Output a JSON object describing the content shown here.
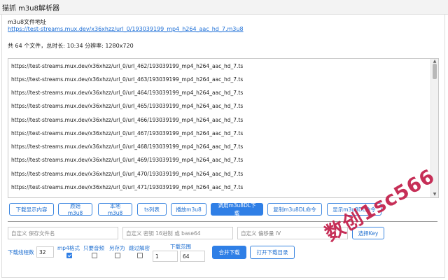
{
  "window": {
    "title": "猫抓 m3u8解析器"
  },
  "source": {
    "label": "m3u8文件地址",
    "url": "https://test-streams.mux.dev/x36xhzz/url_0/193039199_mp4_h264_aac_hd_7.m3u8"
  },
  "summary": "共 64 个文件，总时长: 10:34 分辨率: 1280x720",
  "files": [
    "https://test-streams.mux.dev/x36xhzz/url_0/url_462/193039199_mp4_h264_aac_hd_7.ts",
    "https://test-streams.mux.dev/x36xhzz/url_0/url_463/193039199_mp4_h264_aac_hd_7.ts",
    "https://test-streams.mux.dev/x36xhzz/url_0/url_464/193039199_mp4_h264_aac_hd_7.ts",
    "https://test-streams.mux.dev/x36xhzz/url_0/url_465/193039199_mp4_h264_aac_hd_7.ts",
    "https://test-streams.mux.dev/x36xhzz/url_0/url_466/193039199_mp4_h264_aac_hd_7.ts",
    "https://test-streams.mux.dev/x36xhzz/url_0/url_467/193039199_mp4_h264_aac_hd_7.ts",
    "https://test-streams.mux.dev/x36xhzz/url_0/url_468/193039199_mp4_h264_aac_hd_7.ts",
    "https://test-streams.mux.dev/x36xhzz/url_0/url_469/193039199_mp4_h264_aac_hd_7.ts",
    "https://test-streams.mux.dev/x36xhzz/url_0/url_470/193039199_mp4_h264_aac_hd_7.ts",
    "https://test-streams.mux.dev/x36xhzz/url_0/url_471/193039199_mp4_h264_aac_hd_7.ts"
  ],
  "buttons": {
    "show_download": "下载显示内容",
    "raw_m3u8": "原始m3u8",
    "local_m3u8": "本地m3u8",
    "ts_list": "ts列表",
    "play_m3u8": "播放m3u8",
    "invoke_m3u8dl": "调用m3u8DL下载",
    "copy_m3u8dl": "复制m3u8DL命令",
    "show_m3u8dl": "显示m3u8DL命令",
    "merge_download": "合并下载",
    "open_download_dir": "打开下载目录",
    "key_partial": "选择Key"
  },
  "inputs": {
    "filename_placeholder": "自定义 保存文件名",
    "key_placeholder": "自定义 密钥 16进制 或 base64",
    "iv_placeholder": "自定义 偏移量 IV"
  },
  "options": {
    "threads_label": "下载线程数",
    "threads_value": "32",
    "mp4_label": "mp4格式",
    "mp4_checked": true,
    "audio_only_label": "只要音频",
    "audio_only_checked": false,
    "save_as_label": "另存为",
    "save_as_checked": false,
    "skip_decrypt_label": "跳过解密",
    "skip_decrypt_checked": false,
    "range_label": "下载范围",
    "range_start": "1",
    "range_end": "64"
  },
  "watermark": "数创1sc566",
  "colors": {
    "accent": "#2f7fe6",
    "link": "#1a6dd6",
    "watermark": "#c4244f"
  }
}
